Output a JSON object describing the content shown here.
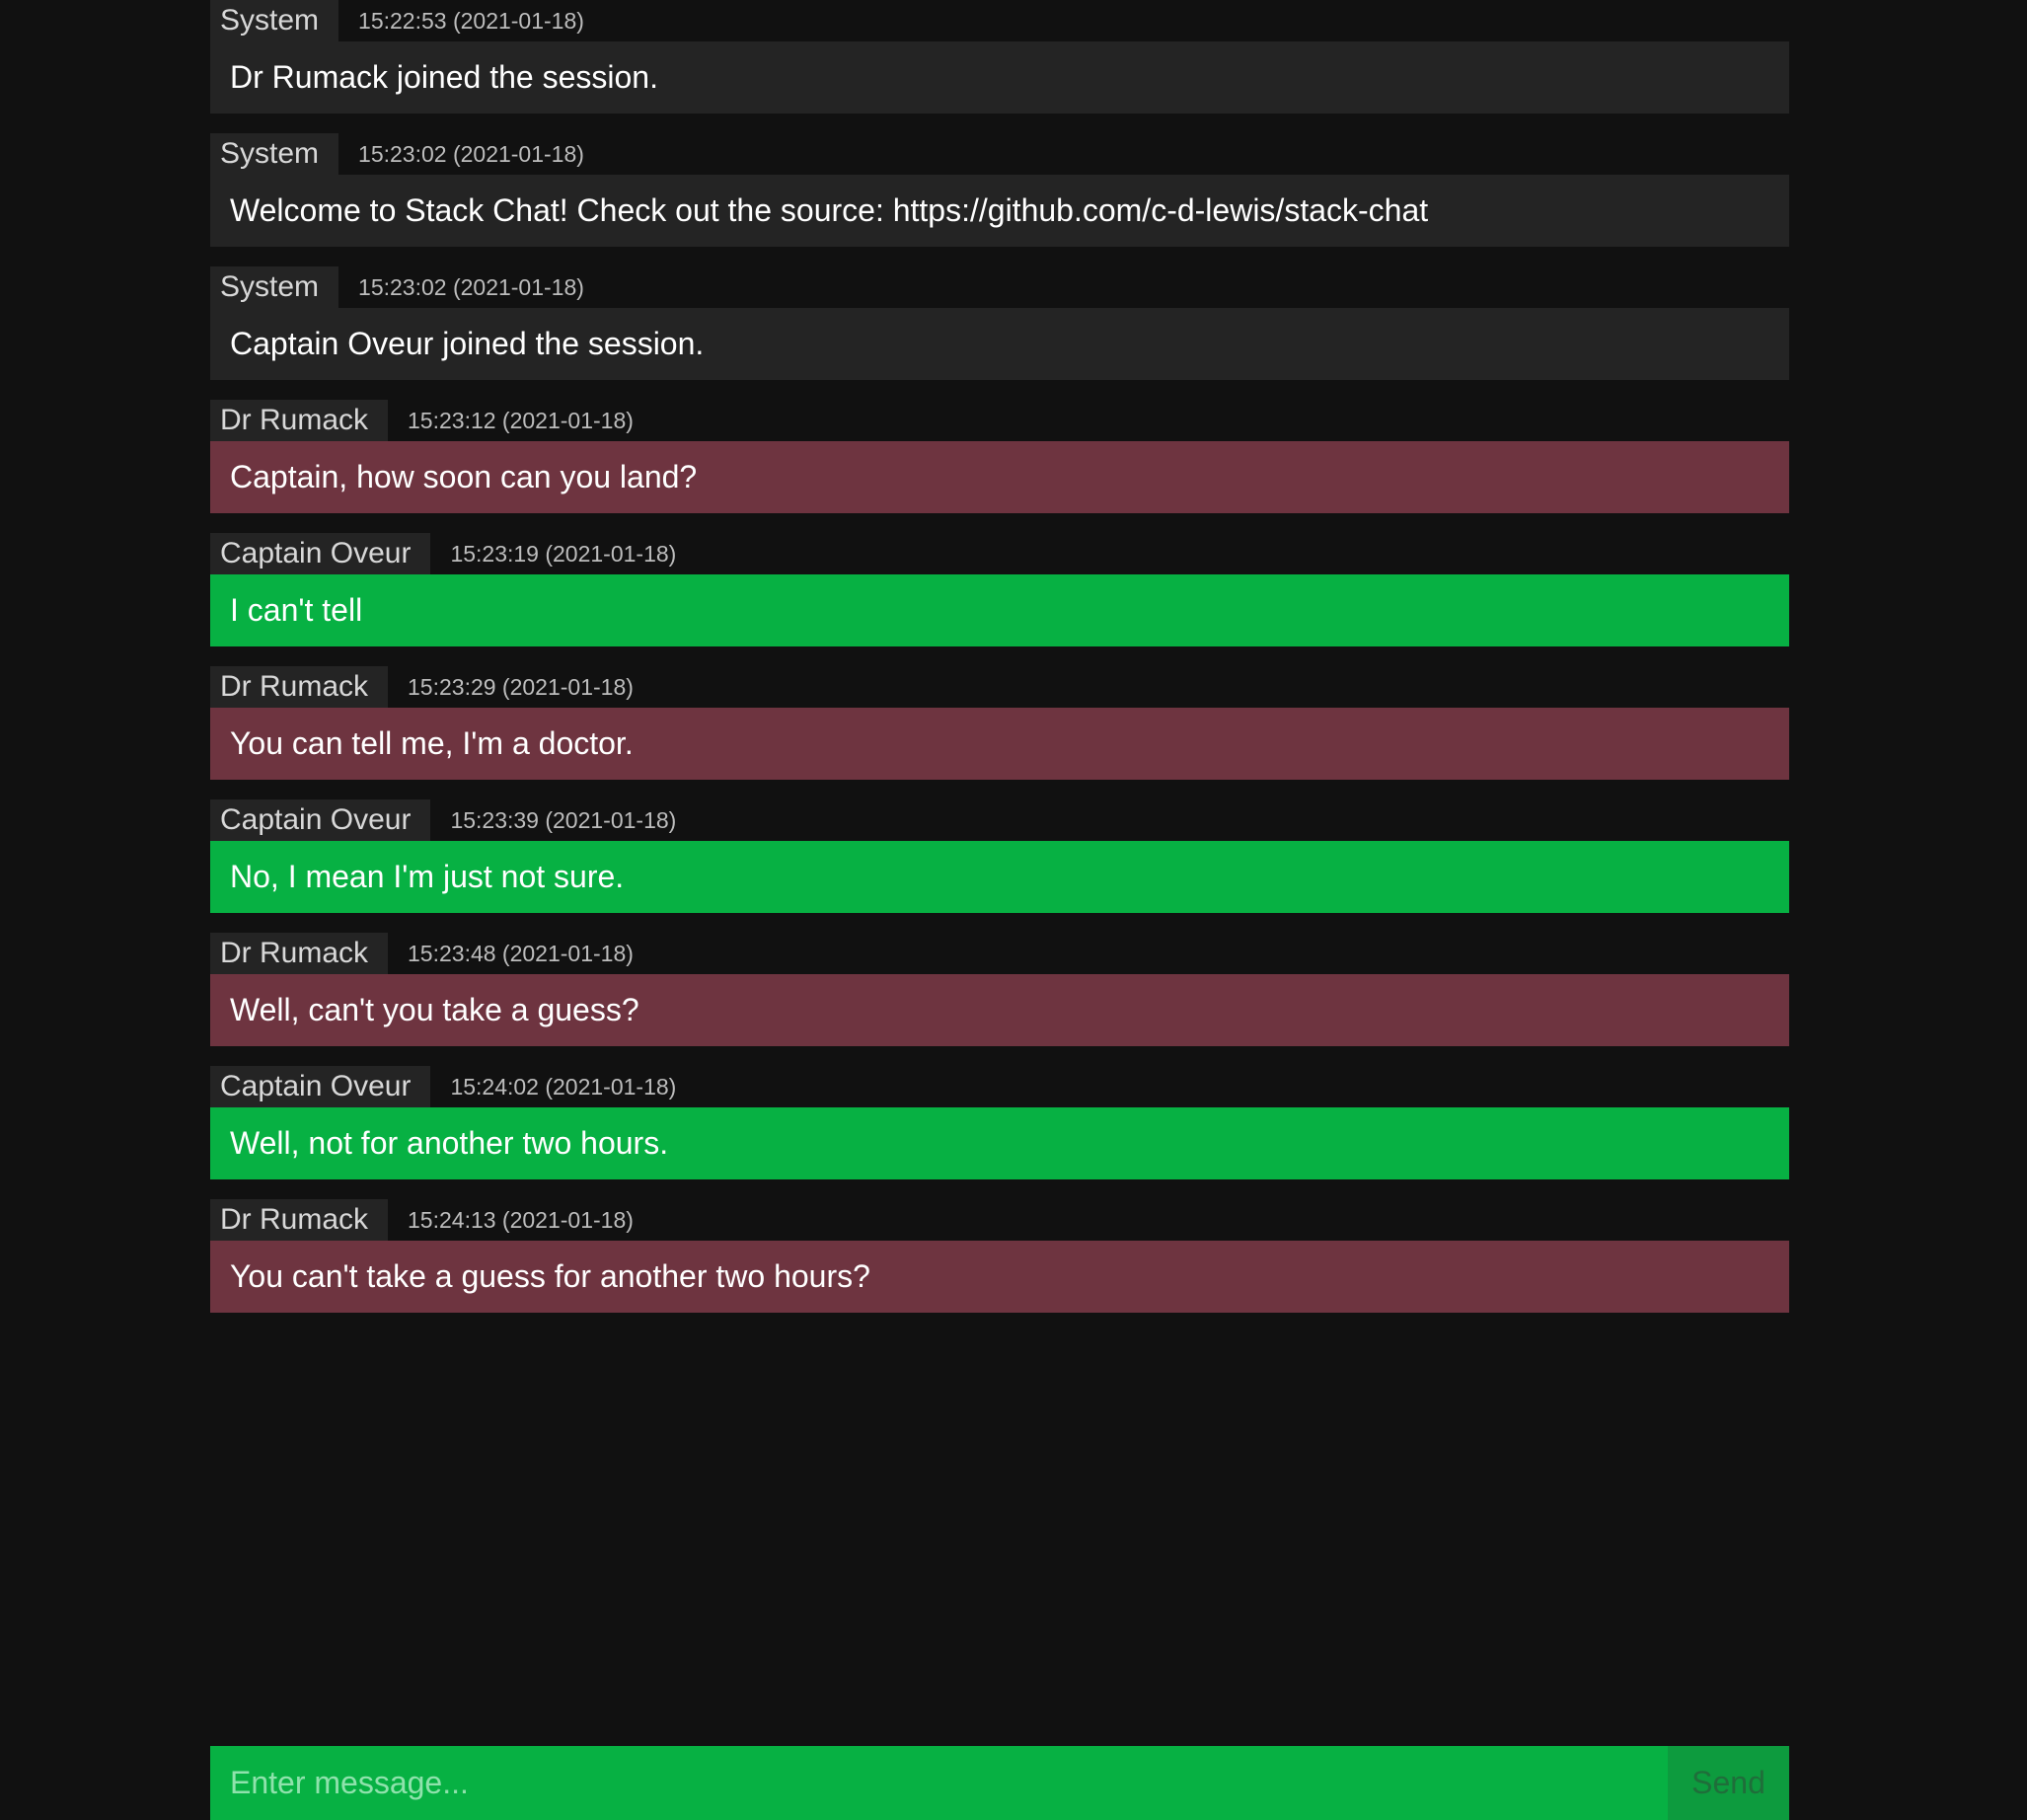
{
  "colors": {
    "background": "#111111",
    "system_bubble": "#242424",
    "doctor_bubble": "#6e3440",
    "captain_bubble": "#07b143",
    "input_background": "#07b143",
    "send_background": "#0d9b3e",
    "send_text": "#1f6e3a"
  },
  "messages": [
    {
      "author": "System",
      "timestamp": "15:22:53 (2021-01-18)",
      "text": "Dr Rumack joined the session.",
      "role": "system"
    },
    {
      "author": "System",
      "timestamp": "15:23:02 (2021-01-18)",
      "text": "Welcome to Stack Chat! Check out the source: https://github.com/c-d-lewis/stack-chat",
      "role": "system"
    },
    {
      "author": "System",
      "timestamp": "15:23:02 (2021-01-18)",
      "text": "Captain Oveur joined the session.",
      "role": "system"
    },
    {
      "author": "Dr Rumack",
      "timestamp": "15:23:12 (2021-01-18)",
      "text": "Captain, how soon can you land?",
      "role": "doctor"
    },
    {
      "author": "Captain Oveur",
      "timestamp": "15:23:19 (2021-01-18)",
      "text": "I can't tell",
      "role": "captain"
    },
    {
      "author": "Dr Rumack",
      "timestamp": "15:23:29 (2021-01-18)",
      "text": "You can tell me, I'm a doctor.",
      "role": "doctor"
    },
    {
      "author": "Captain Oveur",
      "timestamp": "15:23:39 (2021-01-18)",
      "text": "No, I mean I'm just not sure.",
      "role": "captain"
    },
    {
      "author": "Dr Rumack",
      "timestamp": "15:23:48 (2021-01-18)",
      "text": "Well, can't you take a guess?",
      "role": "doctor"
    },
    {
      "author": "Captain Oveur",
      "timestamp": "15:24:02 (2021-01-18)",
      "text": "Well, not for another two hours.",
      "role": "captain"
    },
    {
      "author": "Dr Rumack",
      "timestamp": "15:24:13 (2021-01-18)",
      "text": "You can't take a guess for another two hours?",
      "role": "doctor"
    }
  ],
  "composer": {
    "placeholder": "Enter message...",
    "value": "",
    "send_label": "Send"
  }
}
